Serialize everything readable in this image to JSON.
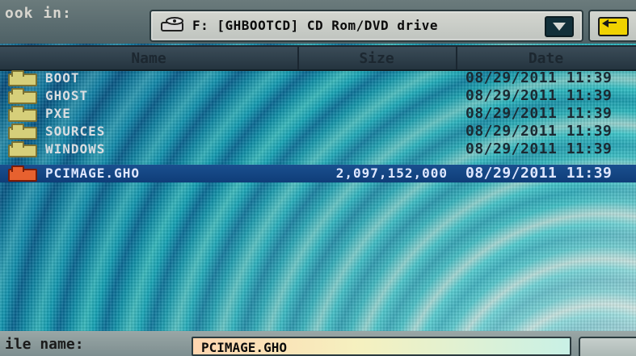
{
  "window": {
    "look_in_label": "ook in:",
    "drive_label": "F: [GHBOOTCD] CD Rom/DVD drive"
  },
  "columns": {
    "name": "Name",
    "size": "Size",
    "date": "Date"
  },
  "files": [
    {
      "name": "BOOT",
      "size": "",
      "date": "08/29/2011 11:39"
    },
    {
      "name": "GHOST",
      "size": "",
      "date": "08/29/2011 11:39"
    },
    {
      "name": "PXE",
      "size": "",
      "date": "08/29/2011 11:39"
    },
    {
      "name": "SOURCES",
      "size": "",
      "date": "08/29/2011 11:39"
    },
    {
      "name": "WINDOWS",
      "size": "",
      "date": "08/29/2011 11:39"
    },
    {
      "name": "PCIMAGE.GHO",
      "size": "2,097,152,000",
      "date": "08/29/2011 11:39",
      "selected": true
    }
  ],
  "bottom": {
    "file_name_label": "ile name:",
    "file_name_value": "PCIMAGE.GHO"
  },
  "icons": {
    "drive": "cd-drive-icon",
    "dropdown": "chevron-down-icon",
    "up": "up-folder-icon",
    "folder": "folder-icon",
    "ghost_file": "ghost-image-icon"
  },
  "colors": {
    "selection": "#0f3d78",
    "folder": "#d6cf7a",
    "ghost_icon": "#e7612f"
  }
}
